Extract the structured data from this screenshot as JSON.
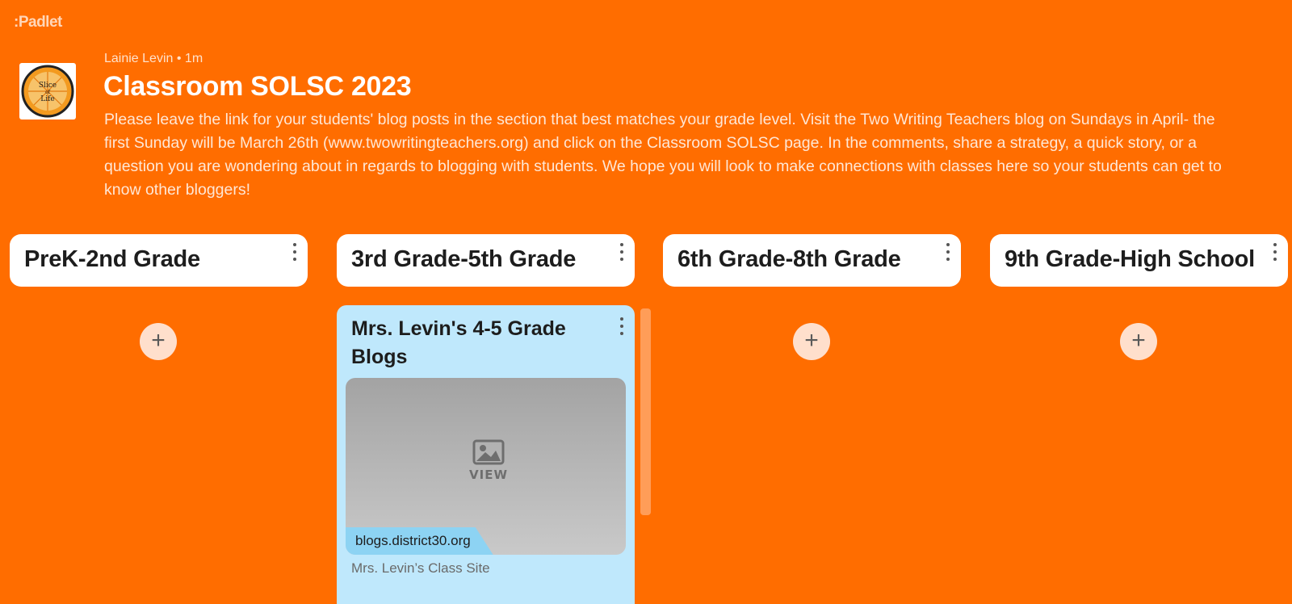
{
  "app": {
    "logo_text": ":Padlet"
  },
  "header": {
    "author": "Lainie Levin",
    "separator": "•",
    "time": "1m",
    "title": "Classroom SOLSC 2023",
    "description": "Please leave the link for your students' blog posts in the section that best matches your grade level. Visit the Two Writing Teachers blog on Sundays in April- the first Sunday will be March 26th (www.twowritingteachers.org) and click on the Classroom SOLSC page. In the comments, share a strategy, a quick story, or a question you are wondering about in regards to blogging with students. We hope you will look to make connections with classes here so your students can get to know other bloggers!",
    "avatar_text_top": "Slice",
    "avatar_text_mid": "of",
    "avatar_text_bottom": "Life"
  },
  "columns": [
    {
      "title": "PreK-2nd Grade",
      "add_label": "+"
    },
    {
      "title": "3rd Grade-5th Grade"
    },
    {
      "title": "6th Grade-8th Grade",
      "add_label": "+"
    },
    {
      "title": "9th Grade-High School",
      "add_label": "+"
    }
  ],
  "post": {
    "title": "Mrs. Levin's 4-5 Grade Blogs",
    "preview_label": "VIEW",
    "link_domain": "blogs.district30.org",
    "caption": "Mrs. Levin’s Class Site"
  },
  "colors": {
    "background": "#ff6d00",
    "card": "#ffffff",
    "post_card": "#bfe8fc",
    "link_tag": "#8dd3f3",
    "add_button": "#ffdfcc"
  },
  "icons": {
    "avatar": "slice-of-life-logo-icon",
    "menu": "more-vertical-icon",
    "add": "plus-icon",
    "preview": "image-icon"
  }
}
